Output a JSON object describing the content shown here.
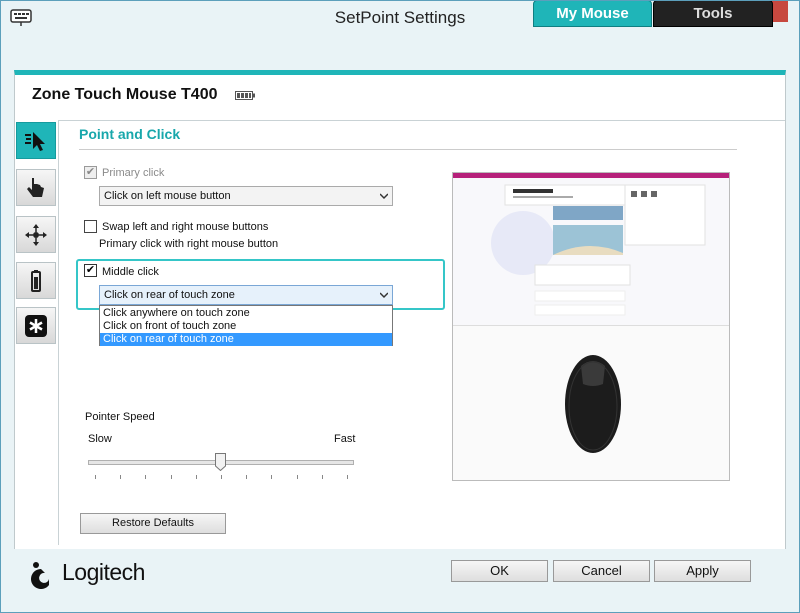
{
  "window": {
    "title": "SetPoint Settings"
  },
  "tabs": [
    {
      "label": "My Mouse",
      "active": true
    },
    {
      "label": "Tools",
      "active": false
    }
  ],
  "device": {
    "name": "Zone Touch Mouse T400"
  },
  "side_nav": [
    {
      "icon": "pointer-icon",
      "active": true
    },
    {
      "icon": "hand-gesture-icon",
      "active": false
    },
    {
      "icon": "move-arrows-icon",
      "active": false
    },
    {
      "icon": "battery-icon",
      "active": false
    },
    {
      "icon": "settings-asterisk-icon",
      "active": false
    }
  ],
  "section": {
    "title": "Point and Click",
    "primary_click": {
      "label": "Primary click",
      "checked": true,
      "disabled": true,
      "selected": "Click on left mouse button"
    },
    "swap": {
      "label": "Swap left and right mouse buttons",
      "checked": false,
      "note": "Primary click with right mouse button"
    },
    "middle_click": {
      "label": "Middle click",
      "checked": true,
      "selected": "Click on rear of touch zone",
      "options": [
        "Click anywhere on touch zone",
        "Click on front of touch zone",
        "Click on rear of touch zone"
      ],
      "selected_index": 2
    },
    "pointer_speed": {
      "label": "Pointer Speed",
      "slow": "Slow",
      "fast": "Fast",
      "value_fraction": 0.5
    }
  },
  "buttons": {
    "restore_defaults": "Restore Defaults",
    "ok": "OK",
    "cancel": "Cancel",
    "apply": "Apply"
  },
  "branding": {
    "logo_text": "Logitech",
    "accent_color": "#1fb5b8"
  }
}
